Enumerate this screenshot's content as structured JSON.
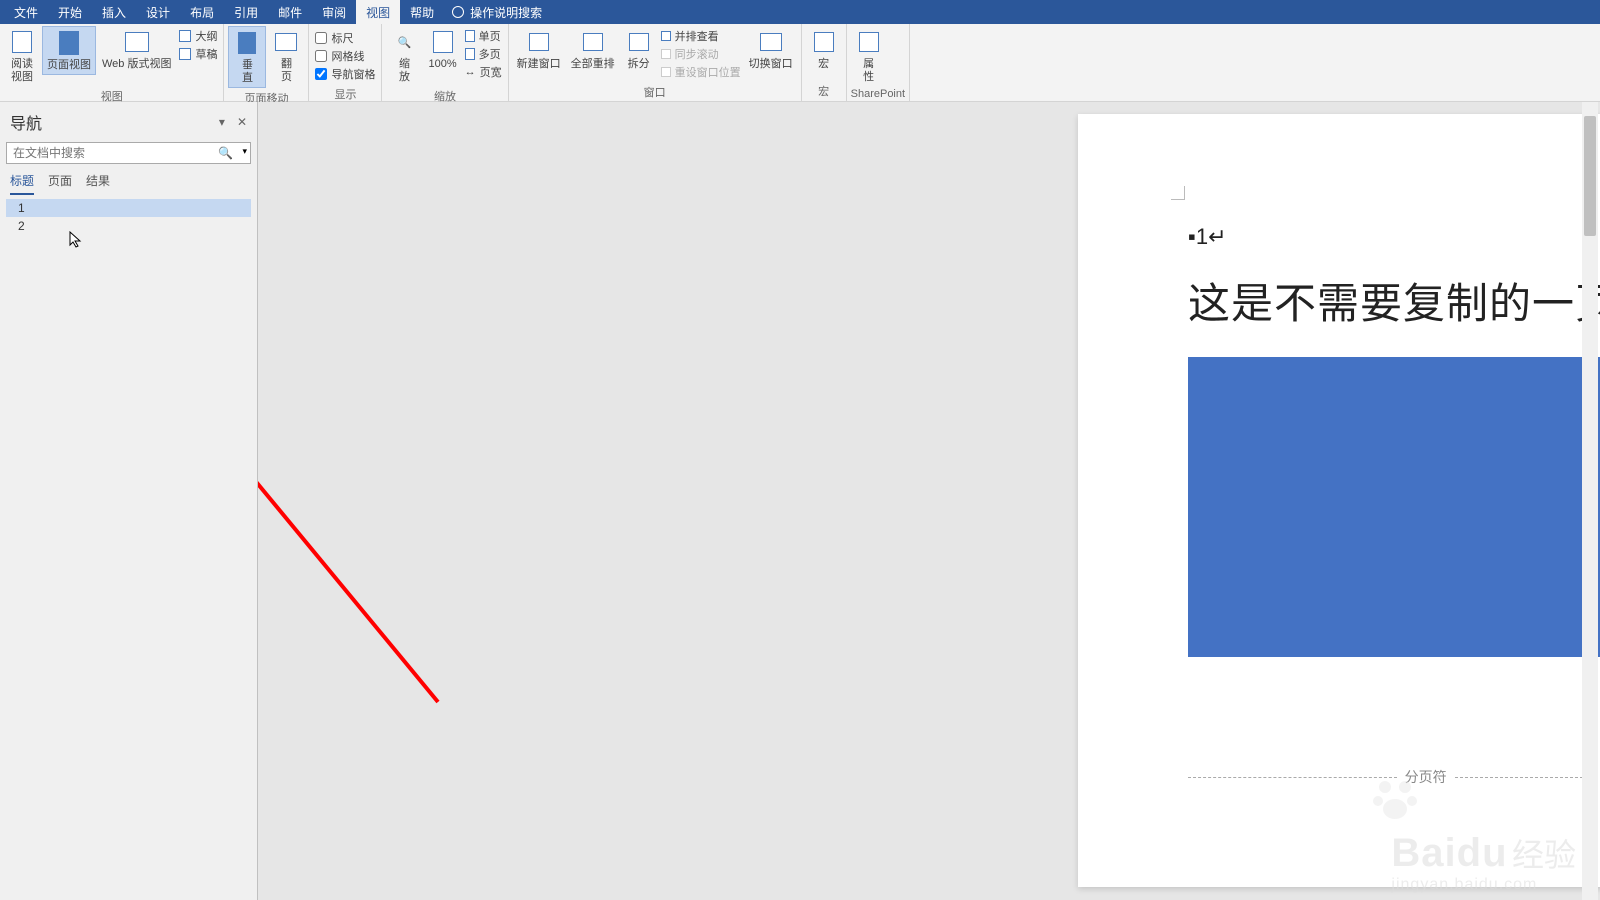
{
  "menubar": {
    "items": [
      "文件",
      "开始",
      "插入",
      "设计",
      "布局",
      "引用",
      "邮件",
      "审阅",
      "视图",
      "帮助"
    ],
    "active_index": 8,
    "tell_me": "操作说明搜索"
  },
  "ribbon": {
    "views": {
      "reading": "阅读\n视图",
      "print": "页面视图",
      "web": "Web 版式视图",
      "outline": "大纲",
      "draft": "草稿",
      "label": "视图"
    },
    "page_movement": {
      "vertical": "垂\n直",
      "side": "翻\n页",
      "label": "页面移动"
    },
    "show": {
      "ruler": "标尺",
      "gridlines": "网格线",
      "nav_pane": "导航窗格",
      "label": "显示"
    },
    "zoom": {
      "zoom": "缩\n放",
      "hundred": "100%",
      "one_page": "单页",
      "multi_page": "多页",
      "page_width": "页宽",
      "label": "缩放"
    },
    "window": {
      "new": "新建窗口",
      "arrange": "全部重排",
      "split": "拆分",
      "side_by_side": "并排查看",
      "sync_scroll": "同步滚动",
      "reset_pos": "重设窗口位置",
      "switch": "切换窗口",
      "label": "窗口"
    },
    "macros": {
      "btn": "宏",
      "label": "宏"
    },
    "sharepoint": {
      "btn": "属\n性",
      "label": "SharePoint"
    }
  },
  "nav": {
    "title": "导航",
    "placeholder": "在文档中搜索",
    "tabs": [
      "标题",
      "页面",
      "结果"
    ],
    "active_tab": 0,
    "items": [
      "1",
      "2"
    ],
    "selected": 0
  },
  "document": {
    "heading_number": "1",
    "heading_text": "这是不需要复制的一页",
    "page_break": "分页符"
  },
  "watermark": {
    "brand": "Baidu",
    "cn": "经验",
    "sub": "jingyan.baidu.com"
  }
}
